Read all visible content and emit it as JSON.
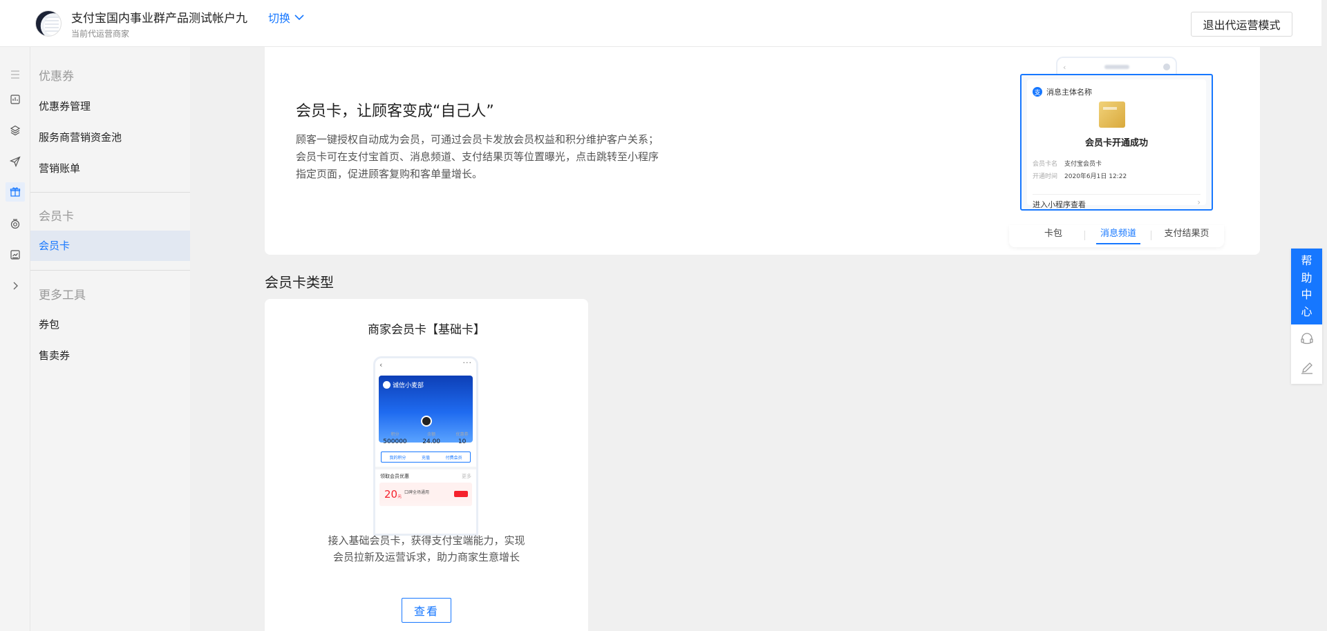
{
  "header": {
    "account_name": "支付宝国内事业群产品测试帐户九",
    "switch_label": "切换",
    "account_sub": "当前代运营商家",
    "exit_label": "退出代运营模式"
  },
  "rail": {
    "icons": [
      "menu-icon",
      "report-icon",
      "cube-icon",
      "send-icon",
      "gift-icon",
      "target-icon",
      "chart-icon",
      "chevron-right-icon"
    ]
  },
  "sidebar": {
    "groups": [
      {
        "title": "优惠券",
        "items": [
          "优惠券管理",
          "服务商营销资金池",
          "营销账单"
        ]
      },
      {
        "title": "会员卡",
        "items": [
          "会员卡"
        ]
      },
      {
        "title": "更多工具",
        "items": [
          "券包",
          "售卖券"
        ]
      }
    ],
    "active_item": "会员卡"
  },
  "banner": {
    "title": "会员卡，让顾客变成“自己人”",
    "desc_lines": [
      "顾客一键授权自动成为会员，可通过会员卡发放会员权益和积分维护客户关系；",
      "会员卡可在支付宝首页、消息频道、支付结果页等位置曝光，点击跳转至小程序",
      "指定页面，促进顾客复购和客单量增长。"
    ],
    "preview": {
      "sender": "消息主体名称",
      "success": "会员卡开通成功",
      "row1_label": "会员卡名",
      "row1_value": "支付宝会员卡",
      "row2_label": "开通时间",
      "row2_value": "2020年6月1日 12:22",
      "link": "进入小程序查看",
      "tabs": [
        "卡包",
        "消息频道",
        "支付结果页"
      ],
      "active_tab": "消息频道"
    }
  },
  "section_title": "会员卡类型",
  "type_card": {
    "title": "商家会员卡【基础卡】",
    "phone": {
      "merchant": "诚信小麦部",
      "stats": [
        {
          "label": "积分",
          "value": "500000"
        },
        {
          "label": "余额",
          "value": "24.00"
        },
        {
          "label": "优惠券",
          "value": "10"
        }
      ],
      "buttons": [
        "我的积分",
        "充值",
        "付费会员"
      ],
      "section": "领取会员优惠",
      "more": "更多",
      "coupon_amount": "20",
      "coupon_unit": "元",
      "coupon_text": "口碑全场通用"
    },
    "desc_lines": [
      "接入基础会员卡，获得支付宝端能力，实现",
      "会员拉新及运营诉求，助力商家生意增长"
    ],
    "button_label": "查看"
  },
  "help": {
    "label": "帮助中心",
    "icons": [
      "headset-icon",
      "edit-icon"
    ]
  },
  "colors": {
    "accent": "#1677ff",
    "background": "#f0f0f0"
  }
}
